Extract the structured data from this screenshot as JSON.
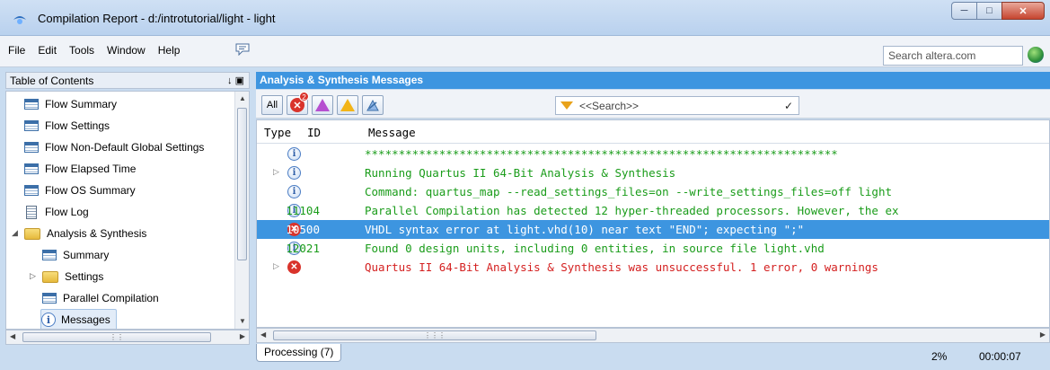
{
  "window": {
    "title": "Compilation Report - d:/introtutorial/light - light",
    "controls": [
      "minimize",
      "maximize",
      "close"
    ]
  },
  "menu": {
    "items": [
      "File",
      "Edit",
      "Tools",
      "Window",
      "Help"
    ],
    "search_placeholder": "Search altera.com"
  },
  "toc": {
    "header": "Table of Contents",
    "pin_glyphs": "↓ ▣",
    "items": [
      {
        "label": "Flow Summary",
        "icon": "table-icon"
      },
      {
        "label": "Flow Settings",
        "icon": "table-icon"
      },
      {
        "label": "Flow Non-Default Global Settings",
        "icon": "table-icon"
      },
      {
        "label": "Flow Elapsed Time",
        "icon": "table-icon"
      },
      {
        "label": "Flow OS Summary",
        "icon": "table-icon"
      },
      {
        "label": "Flow Log",
        "icon": "document-icon"
      },
      {
        "label": "Analysis & Synthesis",
        "icon": "folder-open-icon"
      },
      {
        "label": "Summary",
        "icon": "table-icon"
      },
      {
        "label": "Settings",
        "icon": "folder-icon"
      },
      {
        "label": "Parallel Compilation",
        "icon": "table-icon"
      },
      {
        "label": "Messages",
        "icon": "info-icon"
      }
    ]
  },
  "messages": {
    "header": "Analysis & Synthesis Messages",
    "toolbar": {
      "all_label": "All",
      "error_badge": "2",
      "filter_placeholder": "<<Search>>"
    },
    "columns": [
      "Type",
      "ID",
      "Message"
    ],
    "rows": [
      {
        "type": "info",
        "id": "",
        "message": "**********************************************************************",
        "color": "green"
      },
      {
        "type": "info",
        "id": "",
        "message": "Running Quartus II 64-Bit Analysis & Synthesis",
        "color": "green",
        "expandable": true
      },
      {
        "type": "info",
        "id": "",
        "message": "Command: quartus_map --read_settings_files=on --write_settings_files=off light",
        "color": "green"
      },
      {
        "type": "info",
        "id": "11104",
        "message": "Parallel Compilation has detected 12 hyper-threaded processors. However, the ex",
        "color": "green"
      },
      {
        "type": "error",
        "id": "10500",
        "message": "VHDL syntax error at light.vhd(10) near text \"END\";  expecting \";\"",
        "color": "selected"
      },
      {
        "type": "info",
        "id": "12021",
        "message": "Found 0 design units, including 0 entities, in source file light.vhd",
        "color": "green"
      },
      {
        "type": "error",
        "id": "",
        "message": "Quartus II 64-Bit Analysis & Synthesis was unsuccessful. 1 error, 0 warnings",
        "color": "red",
        "expandable": true
      }
    ],
    "tab_label": "Processing (7)"
  },
  "status": {
    "progress": "2%",
    "elapsed": "00:00:07"
  }
}
